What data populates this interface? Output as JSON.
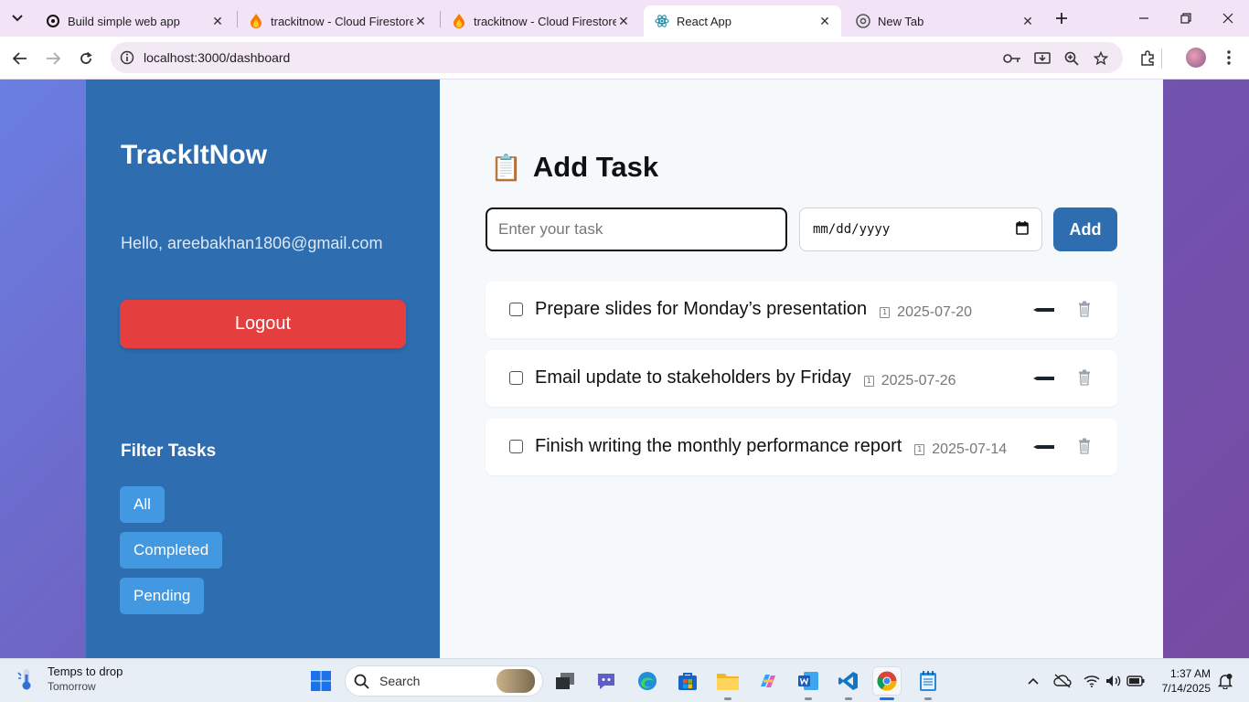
{
  "browser": {
    "tabs": [
      {
        "title": "Build simple web app",
        "favicon": "openai-icon",
        "active": false
      },
      {
        "title": "trackitnow - Cloud Firestore",
        "favicon": "firebase-icon",
        "active": false
      },
      {
        "title": "trackitnow - Cloud Firestore",
        "favicon": "firebase-icon",
        "active": false
      },
      {
        "title": "React App",
        "favicon": "react-icon",
        "active": true
      },
      {
        "title": "New Tab",
        "favicon": "chrome-icon",
        "active": false
      }
    ],
    "url": "localhost:3000/dashboard"
  },
  "sidebar": {
    "brand": "TrackItNow",
    "greeting": "Hello, areebakhan1806@gmail.com",
    "logout_label": "Logout",
    "filter_title": "Filter Tasks",
    "filters": [
      "All",
      "Completed",
      "Pending"
    ]
  },
  "main": {
    "heading_icon": "📋",
    "heading": "Add Task",
    "task_placeholder": "Enter your task",
    "date_placeholder": "mm/dd/yyyy",
    "add_label": "Add",
    "tasks": [
      {
        "text": "Prepare slides for Monday’s presentation",
        "date": "2025-07-20",
        "done": false
      },
      {
        "text": "Email update to stakeholders by Friday",
        "date": "2025-07-26",
        "done": false
      },
      {
        "text": "Finish writing the monthly performance report",
        "date": "2025-07-14",
        "done": false
      }
    ]
  },
  "taskbar": {
    "weather_title": "Temps to drop",
    "weather_sub": "Tomorrow",
    "search_label": "Search",
    "time": "1:37 AM",
    "date": "7/14/2025"
  },
  "colors": {
    "sidebar": "#2d6db0",
    "logout": "#e53e3e",
    "filter_button": "#4299e1",
    "add_button": "#2d6db0"
  }
}
